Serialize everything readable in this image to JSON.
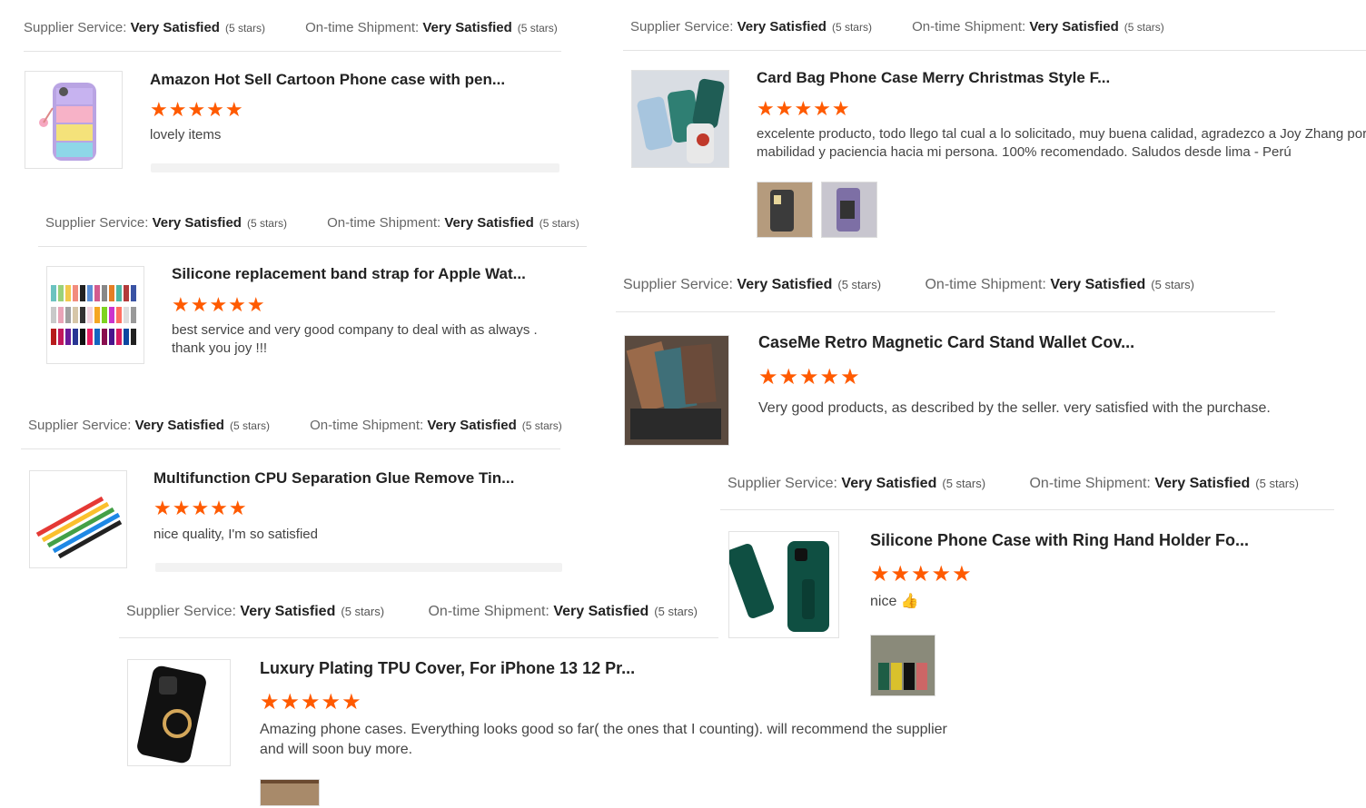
{
  "colors": {
    "star": "#ff5a00",
    "divider": "#e3e3e3"
  },
  "labels": {
    "supplier": "Supplier Service:",
    "shipment": "On-time Shipment:",
    "value": "Very Satisfied",
    "note": "(5 stars)"
  },
  "reviews": [
    {
      "title": "Amazon Hot Sell Cartoon Phone case with pen...",
      "stars": "★★★★★",
      "rating": 5,
      "text": "lovely items",
      "image_icon": "phone-case-image"
    },
    {
      "title": "Card Bag Phone Case Merry Christmas Style F...",
      "stars": "★★★★★",
      "rating": 5,
      "text": "excelente producto, todo llego tal cual a lo solicitado, muy buena calidad, agradezco a Joy Zhang por s",
      "text2": "mabilidad y paciencia hacia mi persona. 100% recomendado. Saludos desde lima - Perú",
      "image_icon": "phone-case-image"
    },
    {
      "title": "Silicone replacement band strap for Apple Wat...",
      "stars": "★★★★★",
      "rating": 5,
      "text": "best service and very good company to deal with as always .",
      "text2": "thank you joy !!!",
      "image_icon": "watch-band-image"
    },
    {
      "title": "CaseMe Retro Magnetic Card Stand Wallet Cov...",
      "stars": "★★★★★",
      "rating": 5,
      "text": "Very good products, as described by the seller. very satisfied with the purchase.",
      "image_icon": "wallet-case-image"
    },
    {
      "title": "Multifunction CPU Separation Glue Remove Tin...",
      "stars": "★★★★★",
      "rating": 5,
      "text": "nice quality, I'm so satisfied",
      "image_icon": "tool-image"
    },
    {
      "title": "Silicone Phone Case with Ring Hand Holder Fo...",
      "stars": "★★★★★",
      "rating": 5,
      "text": "nice",
      "emoji": "👍",
      "image_icon": "phone-case-image"
    },
    {
      "title": "Luxury Plating TPU Cover, For iPhone 13 12 Pr...",
      "stars": "★★★★★",
      "rating": 5,
      "text": "Amazing phone cases. Everything looks good so far( the ones that I counting). will recommend the supplier",
      "text2": "and will soon buy more.",
      "image_icon": "phone-case-image"
    }
  ]
}
